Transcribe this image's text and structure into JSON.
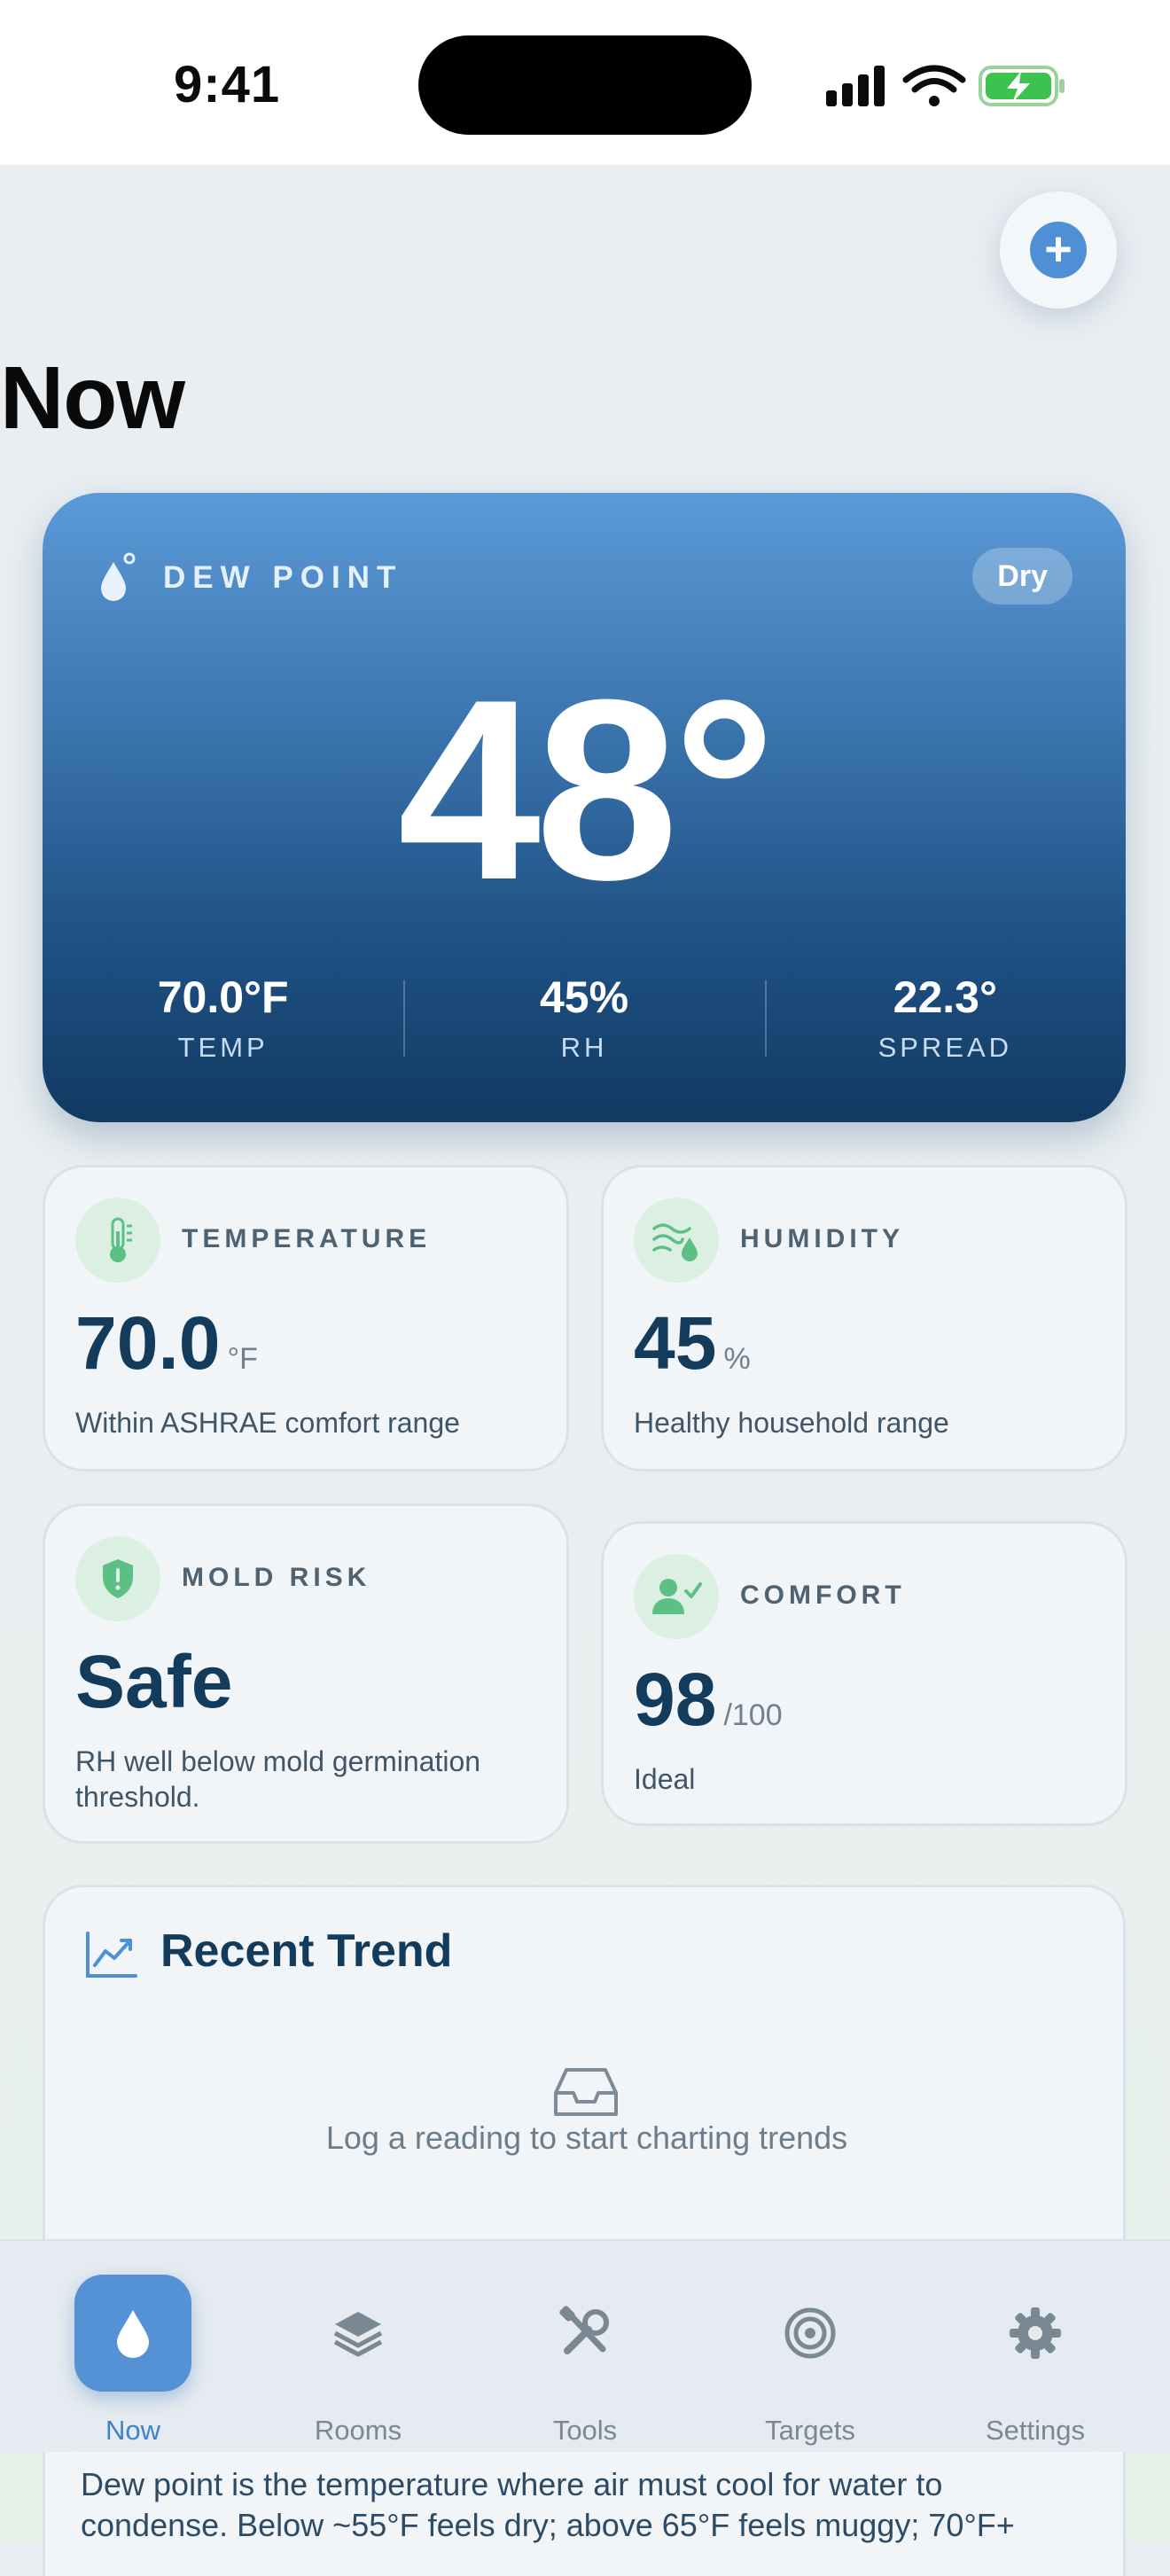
{
  "status_bar": {
    "time": "9:41"
  },
  "header": {
    "title": "Now",
    "add_label": "+"
  },
  "hero": {
    "label": "DEW POINT",
    "badge": "Dry",
    "value": "48°",
    "stats": [
      {
        "value": "70.0°F",
        "label": "TEMP"
      },
      {
        "value": "45%",
        "label": "RH"
      },
      {
        "value": "22.3°",
        "label": "SPREAD"
      }
    ]
  },
  "cards": {
    "temperature": {
      "title": "TEMPERATURE",
      "value": "70.0",
      "unit": "°F",
      "desc": "Within ASHRAE comfort range"
    },
    "humidity": {
      "title": "HUMIDITY",
      "value": "45",
      "unit": "%",
      "desc": "Healthy household range"
    },
    "mold": {
      "title": "MOLD RISK",
      "value": "Safe",
      "desc": "RH well below mold germination threshold."
    },
    "comfort": {
      "title": "COMFORT",
      "value": "98",
      "unit": "/100",
      "desc": "Ideal"
    }
  },
  "trend": {
    "title": "Recent Trend",
    "empty": "Log a reading to start charting trends"
  },
  "tabs": [
    {
      "label": "Now",
      "icon": "drop-icon"
    },
    {
      "label": "Rooms",
      "icon": "layers-icon"
    },
    {
      "label": "Tools",
      "icon": "tools-icon"
    },
    {
      "label": "Targets",
      "icon": "target-icon"
    },
    {
      "label": "Settings",
      "icon": "gear-icon"
    }
  ],
  "footnote": "Dew point is the temperature where air must cool for water to condense. Below ~55°F feels dry; above 65°F feels muggy; 70°F+",
  "colors": {
    "accent": "#4f8fd6",
    "hero_top": "#5b9ad8",
    "hero_bottom": "#123a62",
    "green_icon": "#5cbf83"
  }
}
